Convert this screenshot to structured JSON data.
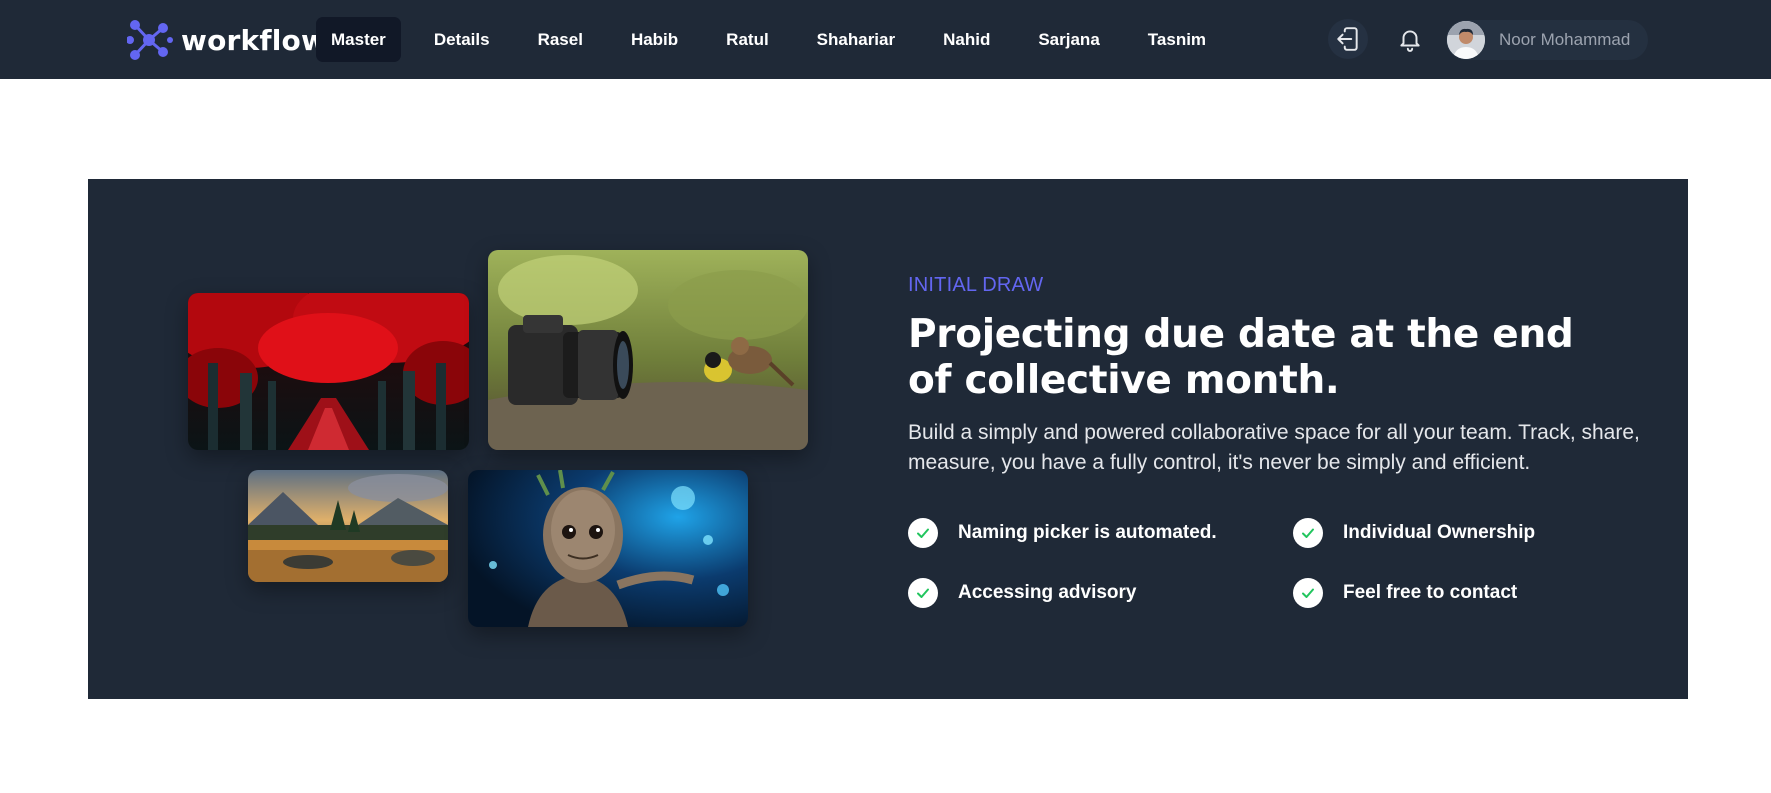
{
  "brand": {
    "name": "workflow",
    "logo_icon": "workflow-logo-icon",
    "accent": "#6366f1"
  },
  "nav": {
    "links": [
      {
        "label": "Master",
        "active": true
      },
      {
        "label": "Details"
      },
      {
        "label": "Rasel"
      },
      {
        "label": "Habib"
      },
      {
        "label": "Ratul"
      },
      {
        "label": "Shahariar"
      },
      {
        "label": "Nahid"
      },
      {
        "label": "Sarjana"
      },
      {
        "label": "Tasnim"
      }
    ],
    "logout_icon": "logout-icon",
    "notification_icon": "bell-icon"
  },
  "user": {
    "name": "Noor Mohammad",
    "avatar_icon": "avatar"
  },
  "hero": {
    "eyebrow": "INITIAL DRAW",
    "headline": "Projecting due date at the end of collective month.",
    "description": "Build a simply and powered collaborative space for all your team. Track, share, measure, you have a fully control, it's never be simply and efficient.",
    "features": [
      "Naming picker is automated.",
      "Individual Ownership",
      "Accessing advisory",
      "Feel free to contact"
    ],
    "feature_icon": "check-circle-icon",
    "images": [
      "red-forest-image",
      "camera-birds-image",
      "mountain-lake-image",
      "groot-image"
    ]
  },
  "colors": {
    "navbar_bg": "#1f2937",
    "hero_bg": "#1f2937",
    "check": "#22c55e",
    "page_bg": "#ffffff"
  }
}
